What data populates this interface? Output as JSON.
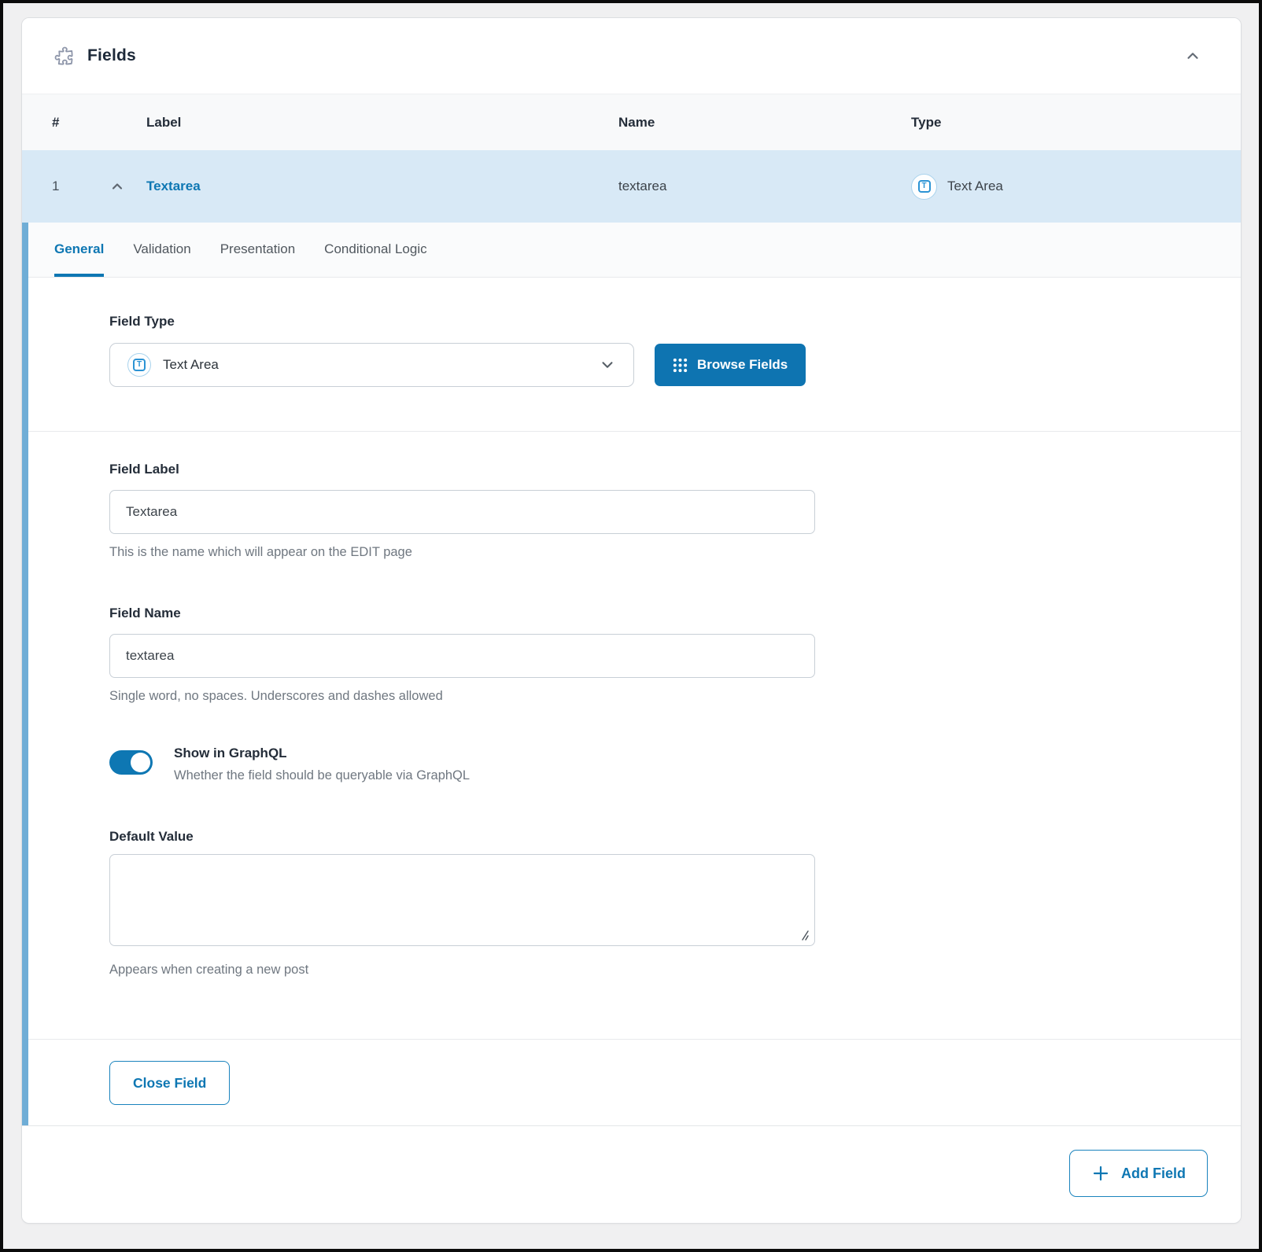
{
  "panel": {
    "title": "Fields"
  },
  "table": {
    "headers": {
      "index": "#",
      "label": "Label",
      "name": "Name",
      "type": "Type"
    },
    "row": {
      "index": "1",
      "label": "Textarea",
      "name": "textarea",
      "type": "Text Area"
    }
  },
  "tabs": [
    {
      "label": "General",
      "active": true
    },
    {
      "label": "Validation",
      "active": false
    },
    {
      "label": "Presentation",
      "active": false
    },
    {
      "label": "Conditional Logic",
      "active": false
    }
  ],
  "form": {
    "field_type": {
      "label": "Field Type",
      "selected": "Text Area",
      "browse_button": "Browse Fields"
    },
    "field_label": {
      "label": "Field Label",
      "value": "Textarea",
      "help": "This is the name which will appear on the EDIT page"
    },
    "field_name": {
      "label": "Field Name",
      "value": "textarea",
      "help": "Single word, no spaces. Underscores and dashes allowed"
    },
    "graphql_toggle": {
      "label": "Show in GraphQL",
      "help": "Whether the field should be queryable via GraphQL",
      "state": "on"
    },
    "default_value": {
      "label": "Default Value",
      "value": "",
      "help": "Appears when creating a new post"
    },
    "close_button": "Close Field"
  },
  "footer": {
    "add_button": "Add Field"
  },
  "icons": {
    "textarea_glyph": "T"
  },
  "colors": {
    "accent_blue": "#0e77b3",
    "button_blue": "#0e74b1",
    "selected_row_bg": "#d8e9f6",
    "accent_bar": "#6fadd6",
    "header_bg": "#f8f9fa",
    "page_bg": "#f0f0f1"
  }
}
